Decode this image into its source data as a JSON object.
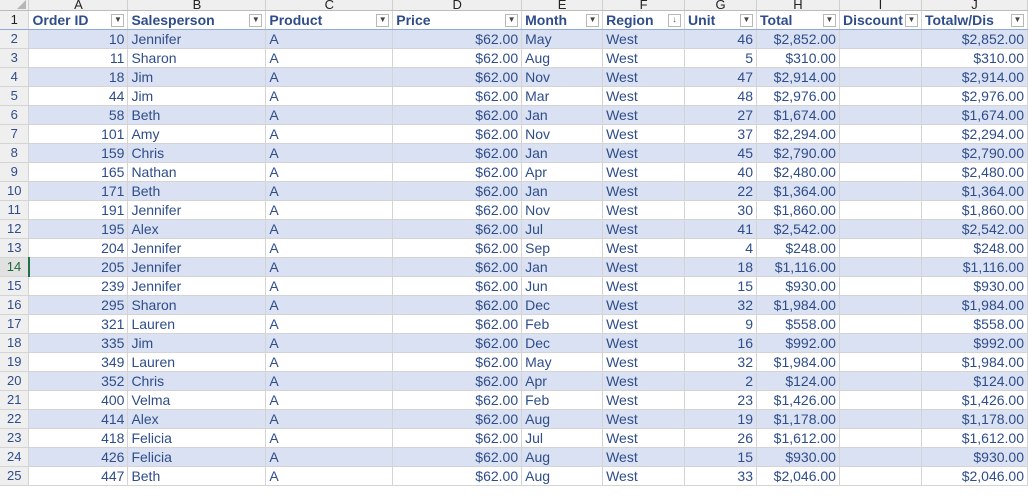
{
  "column_letters": [
    "A",
    "B",
    "C",
    "D",
    "E",
    "F",
    "G",
    "H",
    "I",
    "J"
  ],
  "headers": [
    "Order ID",
    "Salesperson",
    "Product",
    "Price",
    "Month",
    "Region",
    "Unit",
    "Total",
    "Discount",
    "Totalw/Dis"
  ],
  "header_filter_icons": [
    "dropdown-arrow",
    "dropdown-arrow",
    "dropdown-arrow",
    "dropdown-arrow",
    "dropdown-arrow",
    "sort-ascending-filter",
    "dropdown-arrow",
    "dropdown-arrow",
    "dropdown-arrow",
    "dropdown-arrow"
  ],
  "active_row": "14",
  "colors": {
    "band": "#d9e1f2",
    "text": "#2f4d8a",
    "selection": "#217346"
  },
  "rows": [
    {
      "n": "2",
      "v": [
        "10",
        "Jennifer",
        "A",
        "$62.00",
        "May",
        "West",
        "46",
        "$2,852.00",
        "",
        "$2,852.00"
      ]
    },
    {
      "n": "3",
      "v": [
        "11",
        "Sharon",
        "A",
        "$62.00",
        "Aug",
        "West",
        "5",
        "$310.00",
        "",
        "$310.00"
      ]
    },
    {
      "n": "4",
      "v": [
        "18",
        "Jim",
        "A",
        "$62.00",
        "Nov",
        "West",
        "47",
        "$2,914.00",
        "",
        "$2,914.00"
      ]
    },
    {
      "n": "5",
      "v": [
        "44",
        "Jim",
        "A",
        "$62.00",
        "Mar",
        "West",
        "48",
        "$2,976.00",
        "",
        "$2,976.00"
      ]
    },
    {
      "n": "6",
      "v": [
        "58",
        "Beth",
        "A",
        "$62.00",
        "Jan",
        "West",
        "27",
        "$1,674.00",
        "",
        "$1,674.00"
      ]
    },
    {
      "n": "7",
      "v": [
        "101",
        "Amy",
        "A",
        "$62.00",
        "Nov",
        "West",
        "37",
        "$2,294.00",
        "",
        "$2,294.00"
      ]
    },
    {
      "n": "8",
      "v": [
        "159",
        "Chris",
        "A",
        "$62.00",
        "Jan",
        "West",
        "45",
        "$2,790.00",
        "",
        "$2,790.00"
      ]
    },
    {
      "n": "9",
      "v": [
        "165",
        "Nathan",
        "A",
        "$62.00",
        "Apr",
        "West",
        "40",
        "$2,480.00",
        "",
        "$2,480.00"
      ]
    },
    {
      "n": "10",
      "v": [
        "171",
        "Beth",
        "A",
        "$62.00",
        "Jan",
        "West",
        "22",
        "$1,364.00",
        "",
        "$1,364.00"
      ]
    },
    {
      "n": "11",
      "v": [
        "191",
        "Jennifer",
        "A",
        "$62.00",
        "Nov",
        "West",
        "30",
        "$1,860.00",
        "",
        "$1,860.00"
      ]
    },
    {
      "n": "12",
      "v": [
        "195",
        "Alex",
        "A",
        "$62.00",
        "Jul",
        "West",
        "41",
        "$2,542.00",
        "",
        "$2,542.00"
      ]
    },
    {
      "n": "13",
      "v": [
        "204",
        "Jennifer",
        "A",
        "$62.00",
        "Sep",
        "West",
        "4",
        "$248.00",
        "",
        "$248.00"
      ]
    },
    {
      "n": "14",
      "v": [
        "205",
        "Jennifer",
        "A",
        "$62.00",
        "Jan",
        "West",
        "18",
        "$1,116.00",
        "",
        "$1,116.00"
      ]
    },
    {
      "n": "15",
      "v": [
        "239",
        "Jennifer",
        "A",
        "$62.00",
        "Jun",
        "West",
        "15",
        "$930.00",
        "",
        "$930.00"
      ]
    },
    {
      "n": "16",
      "v": [
        "295",
        "Sharon",
        "A",
        "$62.00",
        "Dec",
        "West",
        "32",
        "$1,984.00",
        "",
        "$1,984.00"
      ]
    },
    {
      "n": "17",
      "v": [
        "321",
        "Lauren",
        "A",
        "$62.00",
        "Feb",
        "West",
        "9",
        "$558.00",
        "",
        "$558.00"
      ]
    },
    {
      "n": "18",
      "v": [
        "335",
        "Jim",
        "A",
        "$62.00",
        "Dec",
        "West",
        "16",
        "$992.00",
        "",
        "$992.00"
      ]
    },
    {
      "n": "19",
      "v": [
        "349",
        "Lauren",
        "A",
        "$62.00",
        "May",
        "West",
        "32",
        "$1,984.00",
        "",
        "$1,984.00"
      ]
    },
    {
      "n": "20",
      "v": [
        "352",
        "Chris",
        "A",
        "$62.00",
        "Apr",
        "West",
        "2",
        "$124.00",
        "",
        "$124.00"
      ]
    },
    {
      "n": "21",
      "v": [
        "400",
        "Velma",
        "A",
        "$62.00",
        "Feb",
        "West",
        "23",
        "$1,426.00",
        "",
        "$1,426.00"
      ]
    },
    {
      "n": "22",
      "v": [
        "414",
        "Alex",
        "A",
        "$62.00",
        "Aug",
        "West",
        "19",
        "$1,178.00",
        "",
        "$1,178.00"
      ]
    },
    {
      "n": "23",
      "v": [
        "418",
        "Felicia",
        "A",
        "$62.00",
        "Jul",
        "West",
        "26",
        "$1,612.00",
        "",
        "$1,612.00"
      ]
    },
    {
      "n": "24",
      "v": [
        "426",
        "Felicia",
        "A",
        "$62.00",
        "Aug",
        "West",
        "15",
        "$930.00",
        "",
        "$930.00"
      ]
    },
    {
      "n": "25",
      "v": [
        "447",
        "Beth",
        "A",
        "$62.00",
        "Aug",
        "West",
        "33",
        "$2,046.00",
        "",
        "$2,046.00"
      ]
    }
  ]
}
